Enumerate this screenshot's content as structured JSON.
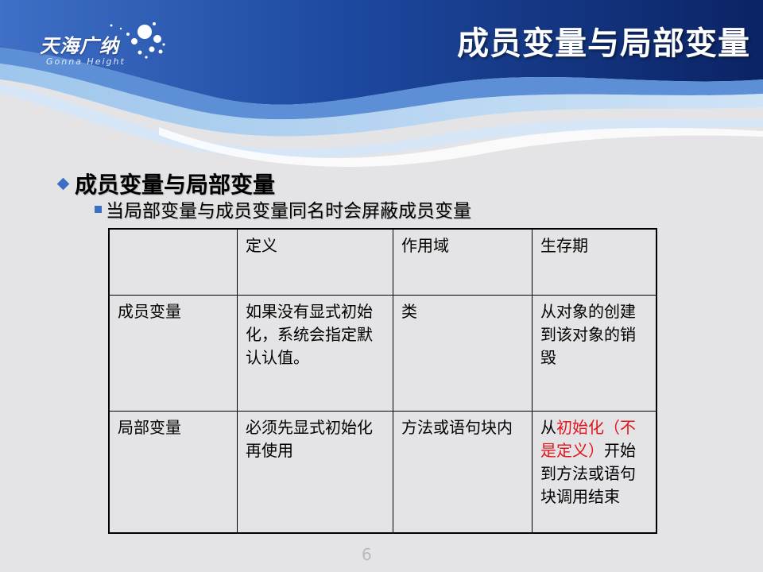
{
  "logo": {
    "text": "天海广纳",
    "sub": "Gonna Height"
  },
  "title": "成员变量与局部变量",
  "bullet_main": "成员变量与局部变量",
  "bullet_sub": "当局部变量与成员变量同名时会屏蔽成员变量",
  "table": {
    "headers": [
      "",
      "定义",
      "作用域",
      "生存期"
    ],
    "rows": [
      {
        "name": "成员变量",
        "definition": "如果没有显式初始化，系统会指定默认认值。",
        "scope": "类",
        "lifetime": "从对象的创建到该对象的销毁"
      },
      {
        "name": "局部变量",
        "definition": "必须先显式初始化再使用",
        "scope": "方法或语句块内",
        "lifetime_prefix": "从",
        "lifetime_highlight": "初始化（不是定义）",
        "lifetime_suffix": "开始到方法或语句块调用结束"
      }
    ]
  },
  "colors": {
    "accent": "#3b6fc4",
    "highlight": "#e0161b",
    "header_dark": "#0d2a6e"
  },
  "page_number": "6"
}
